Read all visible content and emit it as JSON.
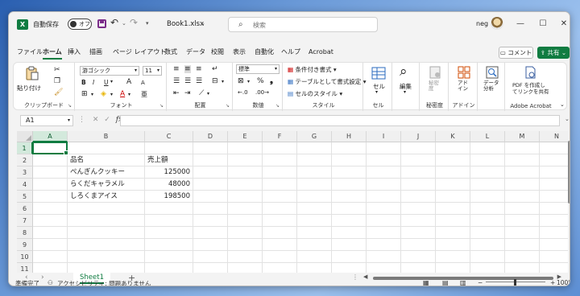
{
  "titlebar": {
    "app_icon": "excel-logo-icon",
    "app_letter": "X",
    "autosave_label": "自動保存",
    "autosave_state": "オフ",
    "document_title": "Book1.xlsx",
    "search_placeholder": "検索",
    "user_name": "neg",
    "minimize": "—",
    "maximize": "☐",
    "close": "✕"
  },
  "menu": {
    "tabs": [
      "ファイル",
      "ホーム",
      "挿入",
      "描画",
      "ページ レイアウト",
      "数式",
      "データ",
      "校閲",
      "表示",
      "自動化",
      "ヘルプ",
      "Acrobat"
    ],
    "active_tab": "ホーム",
    "comment_label": "コメント",
    "share_label": "共有"
  },
  "ribbon": {
    "clipboard": {
      "label": "クリップボード",
      "paste": "貼り付け"
    },
    "font": {
      "label": "フォント",
      "font_name": "游ゴシック",
      "font_size": "11",
      "bold": "B",
      "italic": "I",
      "underline": "U",
      "grow": "A",
      "shrink": "A"
    },
    "alignment": {
      "label": "配置"
    },
    "number": {
      "label": "数値",
      "format": "標準",
      "percent": "%"
    },
    "styles": {
      "label": "スタイル",
      "conditional": "条件付き書式",
      "table": "テーブルとして書式設定",
      "cell_styles": "セルのスタイル"
    },
    "cells": {
      "label": "セル"
    },
    "editing": {
      "label": "編集"
    },
    "sensitivity": {
      "label": "秘密度",
      "btn": "秘密\n度"
    },
    "addins": {
      "label": "アドイン",
      "btn": "アド\nイン"
    },
    "analysis": {
      "btn": "データ\n分析"
    },
    "acrobat": {
      "label": "Adobe Acrobat",
      "btn_line1": "PDF を作成し",
      "btn_line2": "てリンクを共有"
    }
  },
  "formula_bar": {
    "name_box": "A1",
    "fx": "fx",
    "cancel": "✕",
    "enter": "✓",
    "content": ""
  },
  "grid": {
    "columns": [
      "A",
      "B",
      "C",
      "D",
      "E",
      "F",
      "G",
      "H",
      "I",
      "J",
      "K",
      "L",
      "M",
      "N"
    ],
    "rows": [
      "1",
      "2",
      "3",
      "4",
      "5",
      "6",
      "7",
      "8",
      "9",
      "10",
      "11"
    ],
    "selected_cell": "A1",
    "cells": {
      "B2": "品名",
      "C2": "売上額",
      "B3": "ぺんぎんクッキー",
      "C3": "125000",
      "B4": "らくだキャラメル",
      "C4": "48000",
      "B5": "しろくまアイス",
      "C5": "198500"
    }
  },
  "sheets": {
    "tabs": [
      "Sheet1"
    ],
    "active": "Sheet1",
    "add": "+"
  },
  "status": {
    "ready": "準備完了",
    "accessibility": "アクセシビリティ: 問題ありません",
    "zoom": "100%",
    "zoom_minus": "−",
    "zoom_plus": "+"
  },
  "colors": {
    "accent": "#107c41",
    "window_bg": "#f3f3f3"
  }
}
